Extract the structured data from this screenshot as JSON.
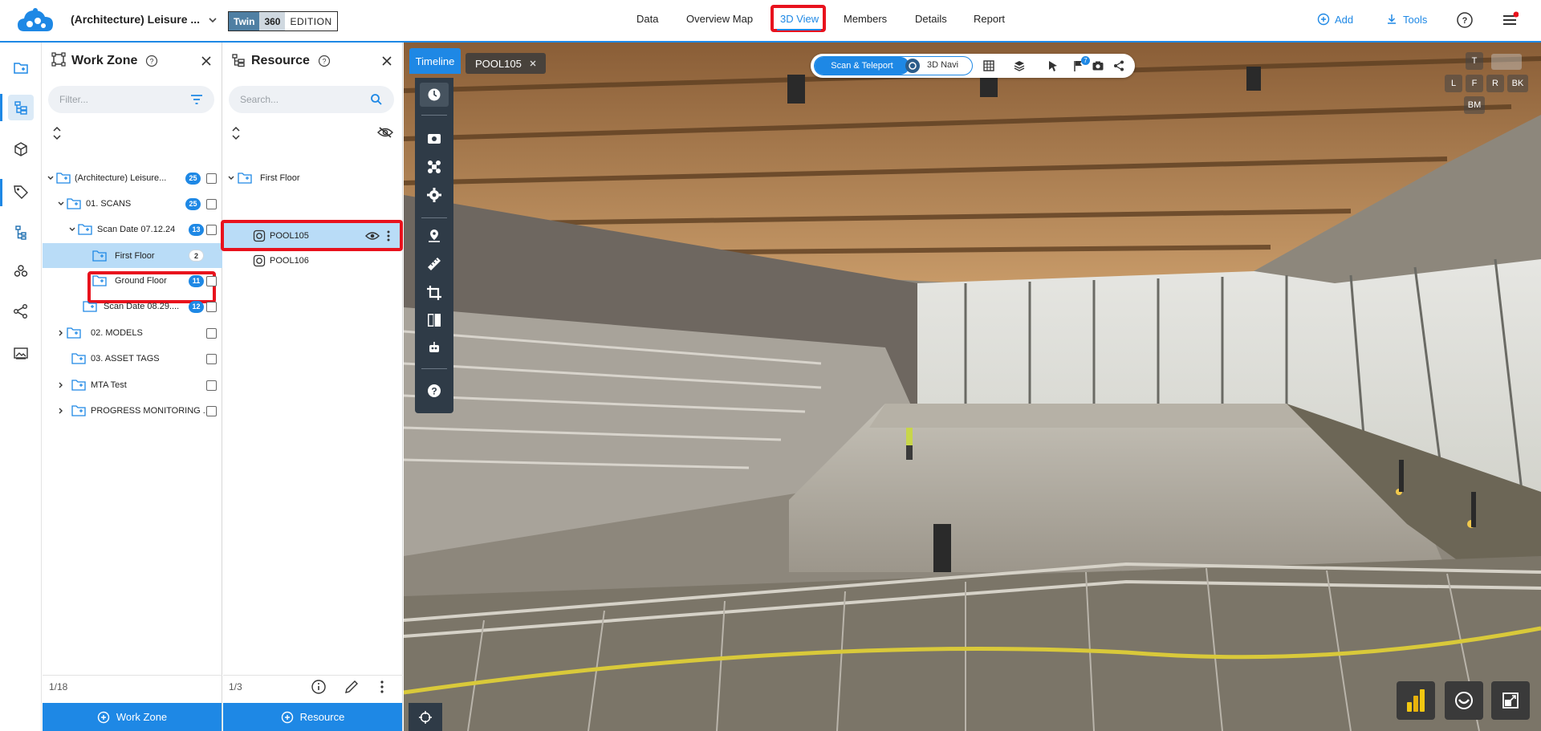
{
  "header": {
    "project_title": "(Architecture) Leisure ...",
    "edition": {
      "twin": "Twin",
      "n360": "360",
      "edition": "EDITION"
    },
    "nav": [
      "Data",
      "Overview Map",
      "3D View",
      "Members",
      "Details",
      "Report"
    ],
    "active_nav": "3D View",
    "add_label": "Add",
    "tools_label": "Tools",
    "accent_color": "#1e88e5",
    "highlight_color": "#e8121d"
  },
  "rail": {
    "icons": [
      "data-folder-icon",
      "tree-structure-icon",
      "cube-icon",
      "tag-icon",
      "hierarchy-icon",
      "cluster-icon",
      "share-icon",
      "image-gallery-icon"
    ],
    "active_index": 1
  },
  "workzone": {
    "title": "Work Zone",
    "filter_placeholder": "Filter...",
    "tree": [
      {
        "label": "(Architecture) Leisure...",
        "badge": "25",
        "expanded": true
      },
      {
        "label": "01. SCANS",
        "badge": "25",
        "expanded": true
      },
      {
        "label": "Scan Date 07.12.24",
        "badge": "13",
        "expanded": true
      },
      {
        "label": "First Floor",
        "badge": "2",
        "selected": true
      },
      {
        "label": "Ground Floor",
        "badge": "11"
      },
      {
        "label": "Scan Date 08.29....",
        "badge": "12"
      },
      {
        "label": "02. MODELS",
        "badge": ""
      },
      {
        "label": "03. ASSET TAGS",
        "badge": ""
      },
      {
        "label": "MTA Test",
        "badge": ""
      },
      {
        "label": "PROGRESS MONITORING ...",
        "badge": ""
      }
    ],
    "count": "1/18",
    "add_button": "Work Zone"
  },
  "resource": {
    "title": "Resource",
    "search_placeholder": "Search...",
    "folder": "First Floor",
    "items": [
      {
        "label": "POOL105",
        "selected": true
      },
      {
        "label": "POOL106",
        "selected": false
      }
    ],
    "count": "1/3",
    "add_button": "Resource"
  },
  "viewer": {
    "timeline_tab": "Timeline",
    "scene_tab": "POOL105",
    "mode_scan": "Scan & Teleport",
    "mode_navi": "3D Navi",
    "view_cube": {
      "top": "T",
      "left": "L",
      "front": "F",
      "right": "R",
      "back": "BK",
      "bottom": "BM"
    },
    "flag_count": "7"
  }
}
